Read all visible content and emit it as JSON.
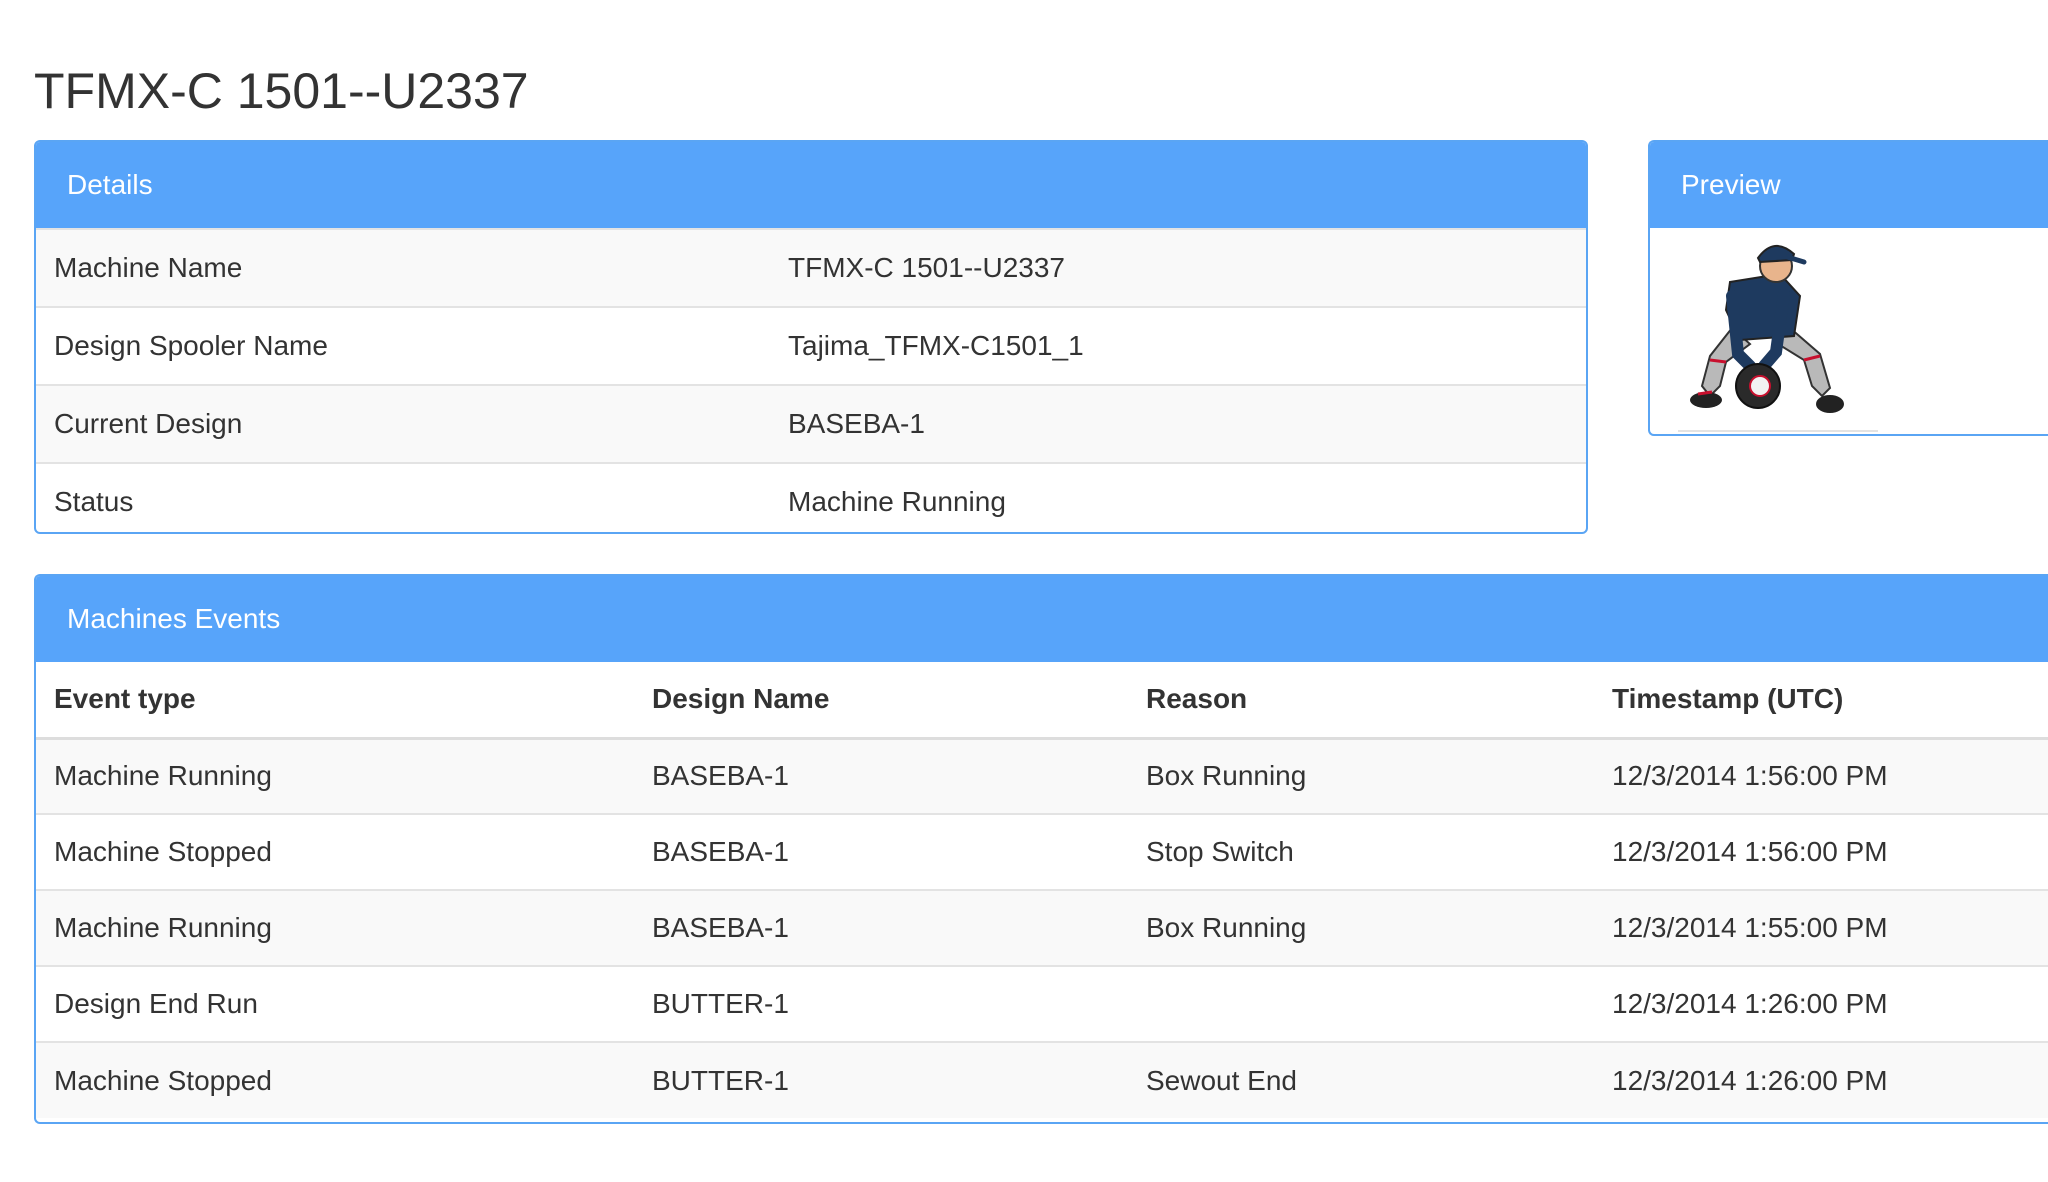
{
  "page": {
    "title": "TFMX-C 1501--U2337"
  },
  "details": {
    "heading": "Details",
    "rows": [
      {
        "label": "Machine Name",
        "value": "TFMX-C 1501--U2337"
      },
      {
        "label": "Design Spooler Name",
        "value": "Tajima_TFMX-C1501_1"
      },
      {
        "label": "Current Design",
        "value": "BASEBA-1"
      },
      {
        "label": "Status",
        "value": "Machine Running"
      }
    ]
  },
  "preview": {
    "heading": "Preview",
    "image": "baseball-fielder-embroidery-design"
  },
  "events": {
    "heading": "Machines Events",
    "columns": [
      "Event type",
      "Design Name",
      "Reason",
      "Timestamp (UTC)"
    ],
    "rows": [
      [
        "Machine Running",
        "BASEBA-1",
        "Box Running",
        "12/3/2014 1:56:00 PM"
      ],
      [
        "Machine Stopped",
        "BASEBA-1",
        "Stop Switch",
        "12/3/2014 1:56:00 PM"
      ],
      [
        "Machine Running",
        "BASEBA-1",
        "Box Running",
        "12/3/2014 1:55:00 PM"
      ],
      [
        "Design End Run",
        "BUTTER-1",
        "",
        "12/3/2014 1:26:00 PM"
      ],
      [
        "Machine Stopped",
        "BUTTER-1",
        "Sewout End",
        "12/3/2014 1:26:00 PM"
      ]
    ]
  },
  "colors": {
    "panel_heading": "#57a4fa",
    "panel_border": "#5aa5f4"
  }
}
